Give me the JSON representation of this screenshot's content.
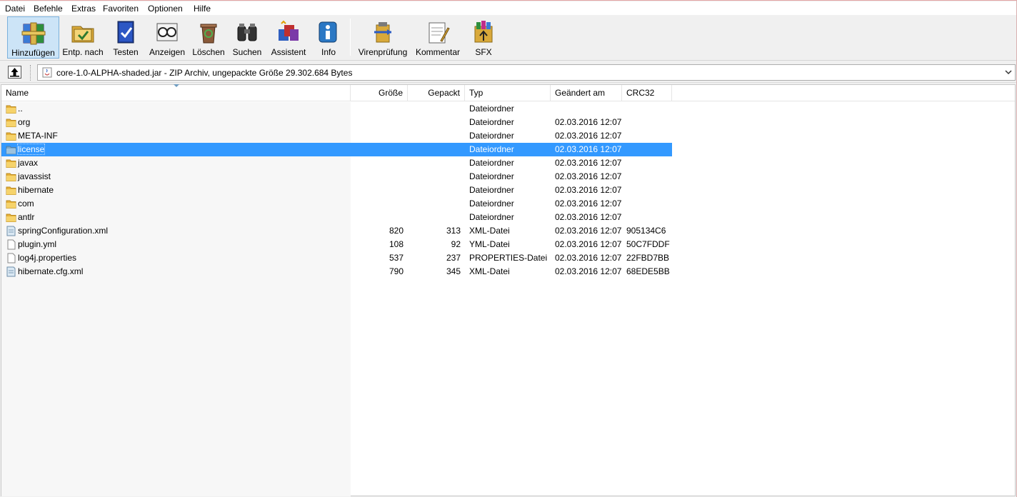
{
  "menu": [
    "Datei",
    "Befehle",
    "Extras",
    "Favoriten",
    "Optionen",
    "Hilfe"
  ],
  "toolbar": [
    {
      "label": "Hinzufügen",
      "icon": "archive-books-icon"
    },
    {
      "label": "Entp. nach",
      "icon": "extract-folder-icon"
    },
    {
      "label": "Testen",
      "icon": "test-book-icon"
    },
    {
      "label": "Anzeigen",
      "icon": "glasses-icon"
    },
    {
      "label": "Löschen",
      "icon": "recycle-bin-icon"
    },
    {
      "label": "Suchen",
      "icon": "binoculars-icon"
    },
    {
      "label": "Assistent",
      "icon": "wizard-icon"
    },
    {
      "label": "Info",
      "icon": "info-icon"
    },
    {
      "label": "Virenprüfung",
      "icon": "virus-scan-icon"
    },
    {
      "label": "Kommentar",
      "icon": "comment-icon"
    },
    {
      "label": "SFX",
      "icon": "sfx-icon"
    }
  ],
  "address": {
    "text": "core-1.0-ALPHA-shaded.jar - ZIP Archiv, ungepackte Größe 29.302.684 Bytes"
  },
  "columns": {
    "name": "Name",
    "size": "Größe",
    "packed": "Gepackt",
    "type": "Typ",
    "modified": "Geändert am",
    "crc": "CRC32"
  },
  "files": [
    {
      "name": "..",
      "size": "",
      "packed": "",
      "type": "Dateiordner",
      "modified": "",
      "crc": "",
      "kind": "folder"
    },
    {
      "name": "org",
      "size": "",
      "packed": "",
      "type": "Dateiordner",
      "modified": "02.03.2016 12:07",
      "crc": "",
      "kind": "folder"
    },
    {
      "name": "META-INF",
      "size": "",
      "packed": "",
      "type": "Dateiordner",
      "modified": "02.03.2016 12:07",
      "crc": "",
      "kind": "folder"
    },
    {
      "name": "license",
      "size": "",
      "packed": "",
      "type": "Dateiordner",
      "modified": "02.03.2016 12:07",
      "crc": "",
      "kind": "folder",
      "selected": true
    },
    {
      "name": "javax",
      "size": "",
      "packed": "",
      "type": "Dateiordner",
      "modified": "02.03.2016 12:07",
      "crc": "",
      "kind": "folder"
    },
    {
      "name": "javassist",
      "size": "",
      "packed": "",
      "type": "Dateiordner",
      "modified": "02.03.2016 12:07",
      "crc": "",
      "kind": "folder"
    },
    {
      "name": "hibernate",
      "size": "",
      "packed": "",
      "type": "Dateiordner",
      "modified": "02.03.2016 12:07",
      "crc": "",
      "kind": "folder"
    },
    {
      "name": "com",
      "size": "",
      "packed": "",
      "type": "Dateiordner",
      "modified": "02.03.2016 12:07",
      "crc": "",
      "kind": "folder"
    },
    {
      "name": "antlr",
      "size": "",
      "packed": "",
      "type": "Dateiordner",
      "modified": "02.03.2016 12:07",
      "crc": "",
      "kind": "folder"
    },
    {
      "name": "springConfiguration.xml",
      "size": "820",
      "packed": "313",
      "type": "XML-Datei",
      "modified": "02.03.2016 12:07",
      "crc": "905134C6",
      "kind": "xml"
    },
    {
      "name": "plugin.yml",
      "size": "108",
      "packed": "92",
      "type": "YML-Datei",
      "modified": "02.03.2016 12:07",
      "crc": "50C7FDDF",
      "kind": "file"
    },
    {
      "name": "log4j.properties",
      "size": "537",
      "packed": "237",
      "type": "PROPERTIES-Datei",
      "modified": "02.03.2016 12:07",
      "crc": "22FBD7BB",
      "kind": "file"
    },
    {
      "name": "hibernate.cfg.xml",
      "size": "790",
      "packed": "345",
      "type": "XML-Datei",
      "modified": "02.03.2016 12:07",
      "crc": "68EDE5BB",
      "kind": "xml"
    }
  ],
  "colors": {
    "selection": "#3399ff",
    "active_button": "#cce4f7",
    "folder": "#f2c24a"
  }
}
